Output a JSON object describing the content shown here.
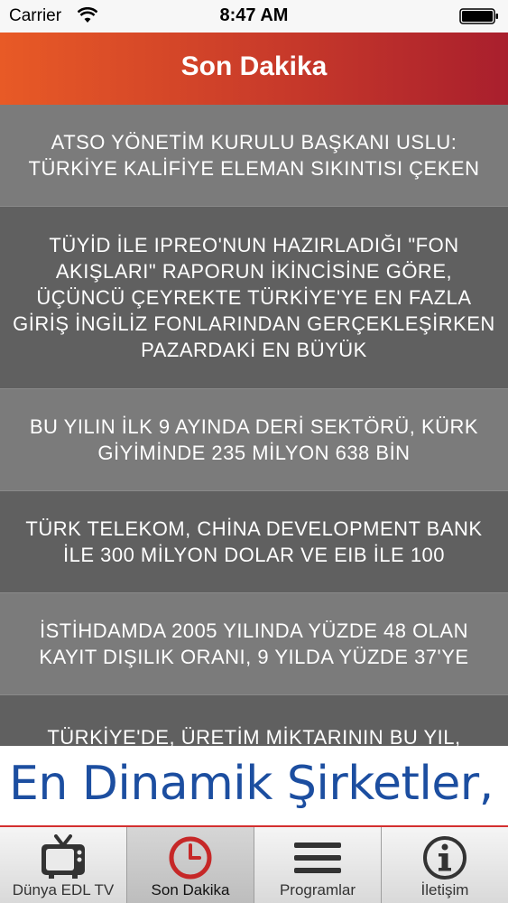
{
  "status_bar": {
    "carrier": "Carrier",
    "time": "8:47 AM"
  },
  "nav": {
    "title": "Son Dakika"
  },
  "news": [
    {
      "text": "ATSO YÖNETİM KURULU BAŞKANI USLU: TÜRKİYE KALİFİYE ELEMAN SIKINTISI ÇEKEN"
    },
    {
      "text": "TÜYİD İLE IPREO'NUN HAZIRLADIĞI \"FON AKIŞLARI\" RAPORUN İKİNCİSİNE GÖRE, ÜÇÜNCÜ ÇEYREKTE TÜRKİYE'YE EN FAZLA GİRİŞ İNGİLİZ FONLARINDAN GERÇEKLEŞİRKEN PAZARDAKİ EN BÜYÜK"
    },
    {
      "text": "BU YILIN İLK 9 AYINDA DERİ SEKTÖRÜ, KÜRK GİYİMİNDE 235 MİLYON 638 BİN"
    },
    {
      "text": "TÜRK TELEKOM, CHİNA DEVELOPMENT BANK İLE 300 MİLYON DOLAR VE EIB İLE 100"
    },
    {
      "text": "İSTİHDAMDA 2005 YILINDA YÜZDE 48 OLAN KAYIT DIŞILIK ORANI, 9 YILDA YÜZDE 37'YE"
    },
    {
      "text": "TÜRKİYE'DE, ÜRETİM MİKTARININ BU YIL,"
    }
  ],
  "banner": {
    "text": "En Dinamik Şirketler,"
  },
  "tabs": [
    {
      "label": "Dünya EDL TV",
      "icon": "tv-icon"
    },
    {
      "label": "Son Dakika",
      "icon": "clock-icon",
      "selected": true
    },
    {
      "label": "Programlar",
      "icon": "menu-icon"
    },
    {
      "label": "İletişim",
      "icon": "info-icon"
    }
  ],
  "colors": {
    "nav_start": "#e85a26",
    "nav_end": "#a91f2d",
    "accent_red": "#c62828",
    "banner_text": "#1c4ea0"
  }
}
